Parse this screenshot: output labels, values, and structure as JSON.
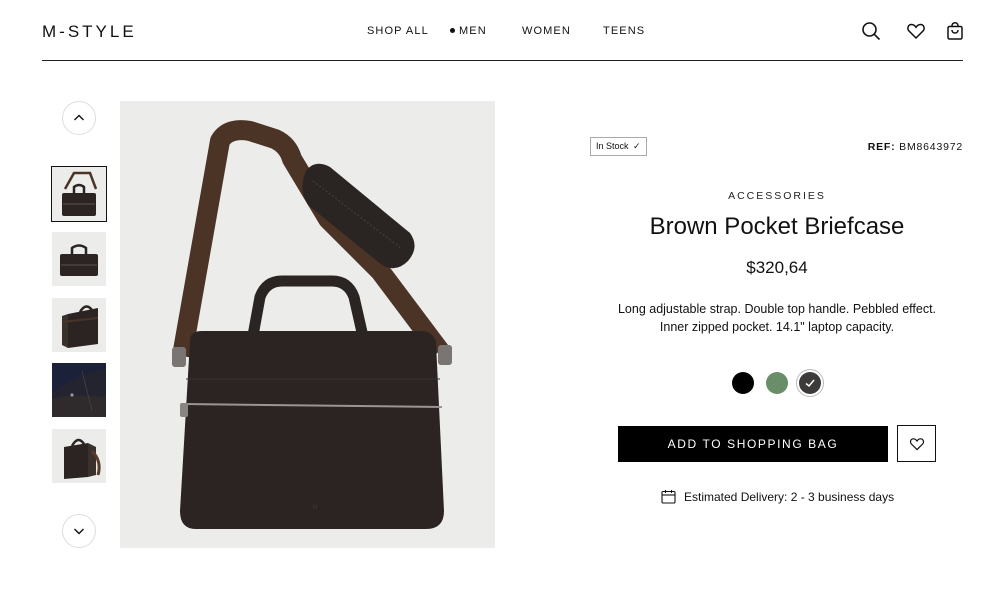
{
  "header": {
    "logo": "M-STYLE",
    "nav": [
      {
        "label": "SHOP ALL"
      },
      {
        "label": "MEN",
        "active": true
      },
      {
        "label": "WOMEN"
      },
      {
        "label": "TEENS"
      }
    ],
    "icons": [
      "search-icon",
      "heart-icon",
      "shopping-bag-icon"
    ]
  },
  "gallery": {
    "thumbnail_count": 5,
    "selected_index": 0,
    "background_color": "#ecedeb"
  },
  "product": {
    "stock_label": "In Stock",
    "ref_label": "REF:",
    "ref_value": "BM8643972",
    "category": "ACCESSORIES",
    "title": "Brown Pocket Briefcase",
    "price": "$320,64",
    "description_line1": "Long adjustable strap. Double top handle. Pebbled effect.",
    "description_line2": "Inner zipped pocket. 14.1\" laptop capacity.",
    "colors": [
      {
        "hex": "#000000"
      },
      {
        "hex": "#6a8d6a"
      },
      {
        "hex": "#3d3a3a",
        "selected": true
      }
    ],
    "add_button": "ADD TO SHOPPING BAG",
    "delivery": "Estimated Delivery: 2 - 3 business days"
  },
  "colors": {
    "accent": "#000000",
    "text": "#111111"
  }
}
